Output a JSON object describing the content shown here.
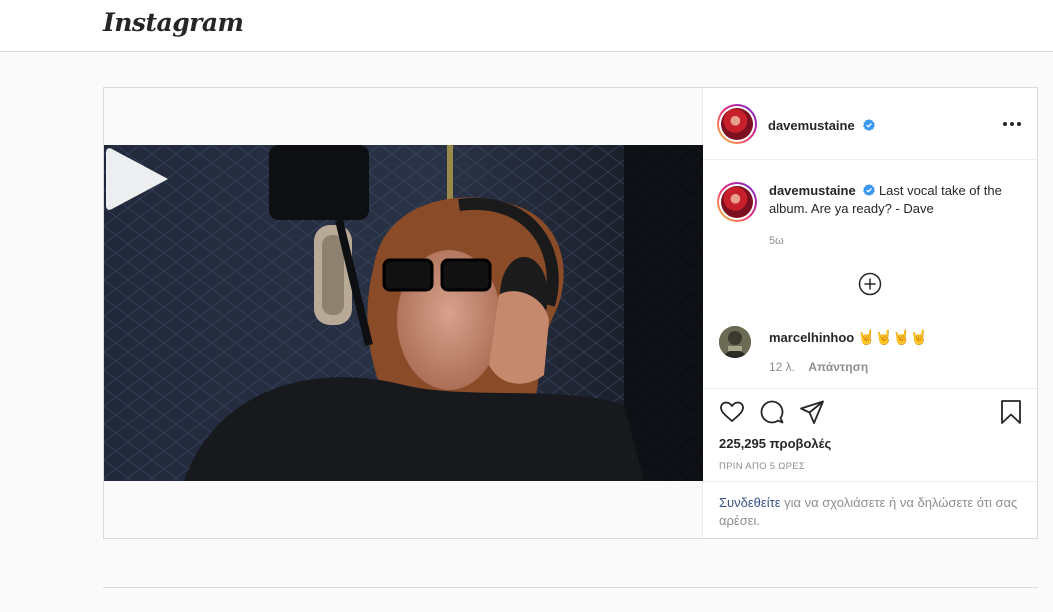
{
  "app": {
    "logo_text": "Instagram"
  },
  "post": {
    "author": "davemustaine",
    "caption": "Last vocal take of the album. Are ya ready? - Dave",
    "caption_time": "5ω",
    "media": {
      "type": "video",
      "play_icon": "play-icon"
    },
    "comments": [
      {
        "username": "marcelhinhoo",
        "text": "🤘🤘🤘🤘",
        "time": "12 λ.",
        "reply_label": "Απάντηση"
      }
    ],
    "load_more_icon": "plus-circle-icon",
    "views": "225,295 προβολές",
    "posted_ago": "ΠΡΙΝ ΑΠΟ 5 ΩΡΕΣ",
    "login_prompt": {
      "link": "Συνδεθείτε",
      "rest": " για να σχολιάσετε ή να δηλώσετε ότι σας αρέσει."
    }
  },
  "colors": {
    "verified": "#3897f0",
    "link": "#385185",
    "border": "#dbdbdb",
    "background": "#fafafa"
  },
  "icons": [
    "heart-icon",
    "comment-icon",
    "share-icon",
    "bookmark-icon",
    "more-options-icon",
    "verified-badge-icon"
  ]
}
